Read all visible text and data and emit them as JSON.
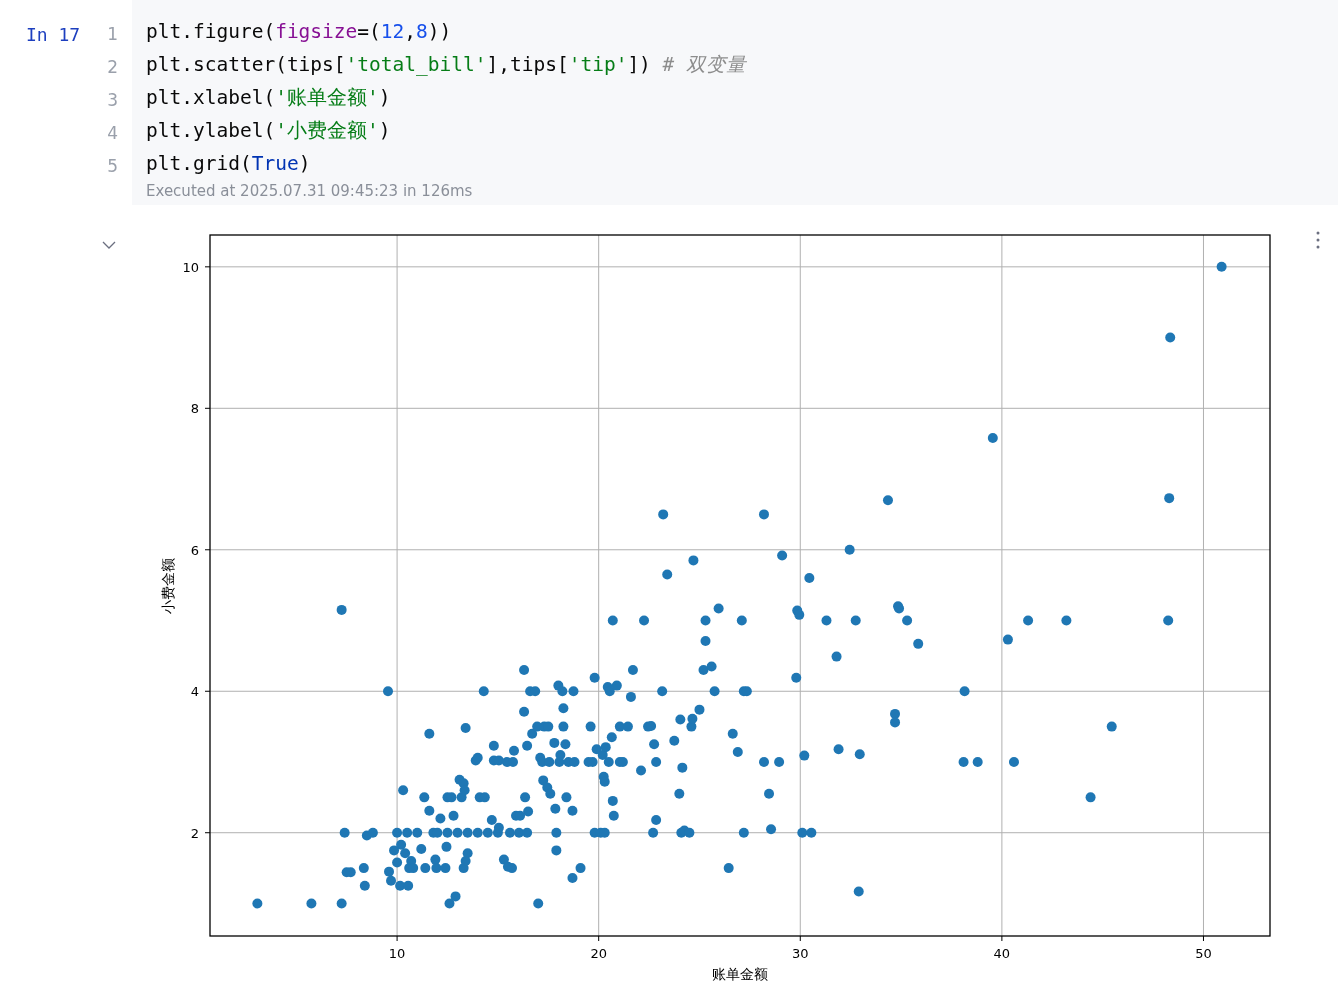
{
  "cell": {
    "prompt": "In 17",
    "lines": [
      {
        "number": "1",
        "tokens": [
          {
            "text": "plt.figure(",
            "kind": "plain"
          },
          {
            "text": "figsize",
            "kind": "param"
          },
          {
            "text": "=(",
            "kind": "plain"
          },
          {
            "text": "12",
            "kind": "number"
          },
          {
            "text": ",",
            "kind": "plain"
          },
          {
            "text": "8",
            "kind": "number"
          },
          {
            "text": "))",
            "kind": "plain"
          }
        ]
      },
      {
        "number": "2",
        "tokens": [
          {
            "text": "plt.scatter(tips[",
            "kind": "plain"
          },
          {
            "text": "'total_bill'",
            "kind": "string"
          },
          {
            "text": "],tips[",
            "kind": "plain"
          },
          {
            "text": "'tip'",
            "kind": "string"
          },
          {
            "text": "]) ",
            "kind": "plain"
          },
          {
            "text": "# 双变量",
            "kind": "comment"
          }
        ]
      },
      {
        "number": "3",
        "tokens": [
          {
            "text": "plt.xlabel(",
            "kind": "plain"
          },
          {
            "text": "'账单金额'",
            "kind": "string"
          },
          {
            "text": ")",
            "kind": "plain"
          }
        ]
      },
      {
        "number": "4",
        "tokens": [
          {
            "text": "plt.ylabel(",
            "kind": "plain"
          },
          {
            "text": "'小费金额'",
            "kind": "string"
          },
          {
            "text": ")",
            "kind": "plain"
          }
        ]
      },
      {
        "number": "5",
        "tokens": [
          {
            "text": "plt.grid(",
            "kind": "plain"
          },
          {
            "text": "True",
            "kind": "keyword"
          },
          {
            "text": ")",
            "kind": "plain"
          }
        ]
      }
    ],
    "status": "Executed at 2025.07.31 09:45:23 in 126ms"
  },
  "output": {
    "chart_data": {
      "type": "scatter",
      "grid": true,
      "xlabel": "账单金额",
      "ylabel": "小费金额",
      "xlim": [
        0.72,
        53.3
      ],
      "ylim": [
        0.54,
        10.45
      ],
      "xticks": [
        10,
        20,
        30,
        40,
        50
      ],
      "yticks": [
        2,
        4,
        6,
        8,
        10
      ],
      "x": [
        3.07,
        5.75,
        7.25,
        7.25,
        9.55,
        7.4,
        7.5,
        7.7,
        8.35,
        8.4,
        8.5,
        8.8,
        9.6,
        9.7,
        9.85,
        10.0,
        10.0,
        10.15,
        10.3,
        10.2,
        10.4,
        10.55,
        10.5,
        10.6,
        10.7,
        10.8,
        11.0,
        11.2,
        11.35,
        11.4,
        11.6,
        11.6,
        11.8,
        11.9,
        11.95,
        12.15,
        12.0,
        12.4,
        12.45,
        12.5,
        12.5,
        12.6,
        12.7,
        12.8,
        12.9,
        13.0,
        13.1,
        13.2,
        13.3,
        13.3,
        13.35,
        13.4,
        13.5,
        13.4,
        13.5,
        13.9,
        14.0,
        14.0,
        14.1,
        14.3,
        14.35,
        14.5,
        14.7,
        14.8,
        14.8,
        15.0,
        15.05,
        15.05,
        15.3,
        15.45,
        15.5,
        15.6,
        15.7,
        15.75,
        15.8,
        15.9,
        16.05,
        16.1,
        16.3,
        16.3,
        16.35,
        16.45,
        16.45,
        16.5,
        16.6,
        16.7,
        16.85,
        16.95,
        17.0,
        17.1,
        17.2,
        17.25,
        17.3,
        17.45,
        17.5,
        17.55,
        17.6,
        17.8,
        17.85,
        17.9,
        17.9,
        18.0,
        18.05,
        18.1,
        18.2,
        18.25,
        18.25,
        18.35,
        18.4,
        18.5,
        18.7,
        18.7,
        18.75,
        18.8,
        19.1,
        19.5,
        19.6,
        19.7,
        19.8,
        19.8,
        19.9,
        20.1,
        20.2,
        20.25,
        20.3,
        20.3,
        20.35,
        20.45,
        20.5,
        20.55,
        20.65,
        20.7,
        20.7,
        20.75,
        20.9,
        21.05,
        21.05,
        21.2,
        21.45,
        21.6,
        21.7,
        22.1,
        22.25,
        22.45,
        22.6,
        22.7,
        22.75,
        22.85,
        22.85,
        23.15,
        23.2,
        23.4,
        23.75,
        24.0,
        24.05,
        24.1,
        24.15,
        24.25,
        24.5,
        24.6,
        24.65,
        24.7,
        25.0,
        25.2,
        25.3,
        25.3,
        25.6,
        25.75,
        25.95,
        26.45,
        26.65,
        26.9,
        27.1,
        27.2,
        27.2,
        27.35,
        28.2,
        28.2,
        28.45,
        28.55,
        28.95,
        29.1,
        29.8,
        29.85,
        29.95,
        30.1,
        30.2,
        30.45,
        30.55,
        31.3,
        31.8,
        31.9,
        32.45,
        32.75,
        32.9,
        32.95,
        34.35,
        34.7,
        34.7,
        34.85,
        34.9,
        35.3,
        35.85,
        38.1,
        38.15,
        38.8,
        39.55,
        40.3,
        40.6,
        41.3,
        43.2,
        44.4,
        45.45,
        48.25,
        48.3,
        48.35,
        50.9
      ],
      "series": [
        {
          "color": "#1f77b4",
          "values": [
            1.0,
            1.0,
            1.0,
            5.15,
            4.0,
            2.0,
            1.44,
            1.44,
            1.5,
            1.25,
            1.96,
            2.0,
            1.45,
            1.32,
            1.75,
            2.0,
            1.58,
            1.25,
            2.6,
            1.83,
            1.71,
            1.25,
            2.0,
            1.5,
            1.6,
            1.5,
            2.0,
            1.77,
            2.5,
            1.5,
            3.4,
            2.31,
            2.0,
            1.62,
            1.5,
            2.2,
            2.0,
            1.5,
            1.8,
            2.5,
            2.0,
            1.0,
            2.5,
            2.24,
            1.1,
            2.0,
            2.75,
            2.5,
            1.5,
            2.7,
            2.6,
            3.48,
            1.71,
            1.6,
            2.0,
            3.02,
            3.06,
            2.0,
            2.5,
            4.0,
            2.5,
            2.0,
            2.18,
            3.23,
            3.02,
            2.0,
            2.07,
            3.02,
            1.62,
            3.0,
            1.52,
            2.0,
            1.5,
            3.0,
            3.16,
            2.24,
            2.0,
            2.24,
            3.71,
            4.3,
            2.5,
            2.0,
            3.23,
            2.3,
            4.0,
            3.4,
            4.0,
            3.5,
            1.0,
            3.06,
            3.0,
            2.74,
            3.5,
            2.64,
            3.5,
            3.0,
            2.55,
            3.27,
            2.34,
            2.0,
            1.75,
            4.08,
            3.0,
            3.1,
            4.0,
            3.76,
            3.5,
            3.25,
            2.5,
            3.0,
            2.31,
            1.36,
            4.0,
            3.0,
            1.5,
            3.0,
            3.5,
            3.0,
            4.19,
            2.0,
            3.18,
            2.0,
            3.1,
            2.79,
            2.72,
            2.0,
            3.21,
            4.06,
            3.0,
            4.0,
            3.35,
            2.45,
            5.0,
            2.24,
            4.08,
            3.5,
            3.0,
            3.0,
            3.5,
            3.92,
            4.3,
            2.88,
            5.0,
            3.5,
            3.51,
            2.0,
            3.25,
            2.18,
            3.0,
            4.0,
            6.5,
            5.65,
            3.3,
            2.55,
            3.6,
            2.0,
            2.92,
            2.03,
            2.0,
            3.5,
            3.61,
            5.85,
            3.74,
            4.3,
            4.71,
            5.0,
            4.35,
            4.0,
            5.17,
            1.5,
            3.4,
            3.14,
            5.0,
            2.0,
            4.0,
            4.0,
            6.5,
            3.0,
            2.55,
            2.05,
            3.0,
            5.92,
            4.19,
            5.14,
            5.08,
            2.0,
            3.09,
            5.6,
            2.0,
            5.0,
            4.49,
            3.18,
            6.0,
            5.0,
            1.17,
            3.11,
            6.7,
            3.68,
            3.56,
            5.2,
            5.17,
            5.0,
            4.67,
            3.0,
            4.0,
            3.0,
            7.58,
            4.73,
            3.0,
            5.0,
            5.0,
            2.5,
            3.5,
            5.0,
            6.73,
            9.0,
            10.0
          ]
        }
      ]
    }
  }
}
